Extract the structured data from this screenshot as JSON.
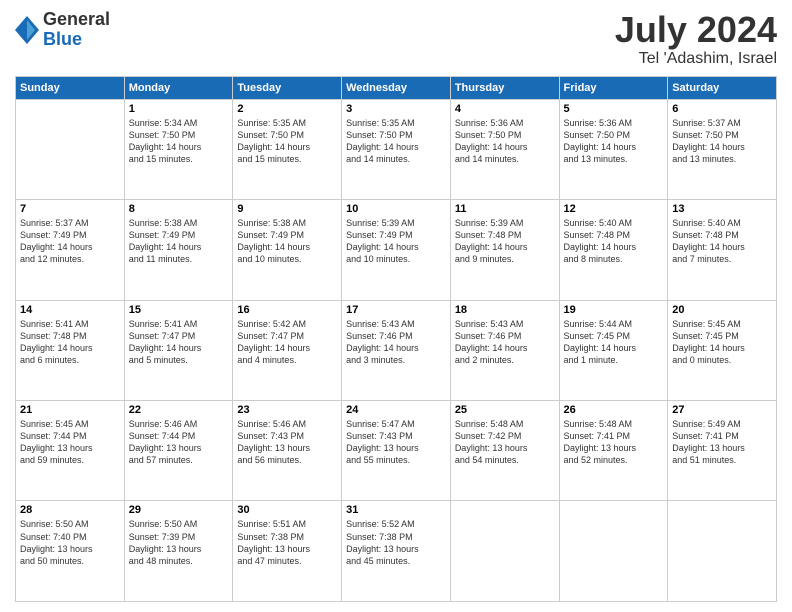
{
  "logo": {
    "general": "General",
    "blue": "Blue"
  },
  "header": {
    "month": "July 2024",
    "location": "Tel 'Adashim, Israel"
  },
  "weekdays": [
    "Sunday",
    "Monday",
    "Tuesday",
    "Wednesday",
    "Thursday",
    "Friday",
    "Saturday"
  ],
  "weeks": [
    [
      {
        "day": "",
        "info": ""
      },
      {
        "day": "1",
        "info": "Sunrise: 5:34 AM\nSunset: 7:50 PM\nDaylight: 14 hours\nand 15 minutes."
      },
      {
        "day": "2",
        "info": "Sunrise: 5:35 AM\nSunset: 7:50 PM\nDaylight: 14 hours\nand 15 minutes."
      },
      {
        "day": "3",
        "info": "Sunrise: 5:35 AM\nSunset: 7:50 PM\nDaylight: 14 hours\nand 14 minutes."
      },
      {
        "day": "4",
        "info": "Sunrise: 5:36 AM\nSunset: 7:50 PM\nDaylight: 14 hours\nand 14 minutes."
      },
      {
        "day": "5",
        "info": "Sunrise: 5:36 AM\nSunset: 7:50 PM\nDaylight: 14 hours\nand 13 minutes."
      },
      {
        "day": "6",
        "info": "Sunrise: 5:37 AM\nSunset: 7:50 PM\nDaylight: 14 hours\nand 13 minutes."
      }
    ],
    [
      {
        "day": "7",
        "info": "Sunrise: 5:37 AM\nSunset: 7:49 PM\nDaylight: 14 hours\nand 12 minutes."
      },
      {
        "day": "8",
        "info": "Sunrise: 5:38 AM\nSunset: 7:49 PM\nDaylight: 14 hours\nand 11 minutes."
      },
      {
        "day": "9",
        "info": "Sunrise: 5:38 AM\nSunset: 7:49 PM\nDaylight: 14 hours\nand 10 minutes."
      },
      {
        "day": "10",
        "info": "Sunrise: 5:39 AM\nSunset: 7:49 PM\nDaylight: 14 hours\nand 10 minutes."
      },
      {
        "day": "11",
        "info": "Sunrise: 5:39 AM\nSunset: 7:48 PM\nDaylight: 14 hours\nand 9 minutes."
      },
      {
        "day": "12",
        "info": "Sunrise: 5:40 AM\nSunset: 7:48 PM\nDaylight: 14 hours\nand 8 minutes."
      },
      {
        "day": "13",
        "info": "Sunrise: 5:40 AM\nSunset: 7:48 PM\nDaylight: 14 hours\nand 7 minutes."
      }
    ],
    [
      {
        "day": "14",
        "info": "Sunrise: 5:41 AM\nSunset: 7:48 PM\nDaylight: 14 hours\nand 6 minutes."
      },
      {
        "day": "15",
        "info": "Sunrise: 5:41 AM\nSunset: 7:47 PM\nDaylight: 14 hours\nand 5 minutes."
      },
      {
        "day": "16",
        "info": "Sunrise: 5:42 AM\nSunset: 7:47 PM\nDaylight: 14 hours\nand 4 minutes."
      },
      {
        "day": "17",
        "info": "Sunrise: 5:43 AM\nSunset: 7:46 PM\nDaylight: 14 hours\nand 3 minutes."
      },
      {
        "day": "18",
        "info": "Sunrise: 5:43 AM\nSunset: 7:46 PM\nDaylight: 14 hours\nand 2 minutes."
      },
      {
        "day": "19",
        "info": "Sunrise: 5:44 AM\nSunset: 7:45 PM\nDaylight: 14 hours\nand 1 minute."
      },
      {
        "day": "20",
        "info": "Sunrise: 5:45 AM\nSunset: 7:45 PM\nDaylight: 14 hours\nand 0 minutes."
      }
    ],
    [
      {
        "day": "21",
        "info": "Sunrise: 5:45 AM\nSunset: 7:44 PM\nDaylight: 13 hours\nand 59 minutes."
      },
      {
        "day": "22",
        "info": "Sunrise: 5:46 AM\nSunset: 7:44 PM\nDaylight: 13 hours\nand 57 minutes."
      },
      {
        "day": "23",
        "info": "Sunrise: 5:46 AM\nSunset: 7:43 PM\nDaylight: 13 hours\nand 56 minutes."
      },
      {
        "day": "24",
        "info": "Sunrise: 5:47 AM\nSunset: 7:43 PM\nDaylight: 13 hours\nand 55 minutes."
      },
      {
        "day": "25",
        "info": "Sunrise: 5:48 AM\nSunset: 7:42 PM\nDaylight: 13 hours\nand 54 minutes."
      },
      {
        "day": "26",
        "info": "Sunrise: 5:48 AM\nSunset: 7:41 PM\nDaylight: 13 hours\nand 52 minutes."
      },
      {
        "day": "27",
        "info": "Sunrise: 5:49 AM\nSunset: 7:41 PM\nDaylight: 13 hours\nand 51 minutes."
      }
    ],
    [
      {
        "day": "28",
        "info": "Sunrise: 5:50 AM\nSunset: 7:40 PM\nDaylight: 13 hours\nand 50 minutes."
      },
      {
        "day": "29",
        "info": "Sunrise: 5:50 AM\nSunset: 7:39 PM\nDaylight: 13 hours\nand 48 minutes."
      },
      {
        "day": "30",
        "info": "Sunrise: 5:51 AM\nSunset: 7:38 PM\nDaylight: 13 hours\nand 47 minutes."
      },
      {
        "day": "31",
        "info": "Sunrise: 5:52 AM\nSunset: 7:38 PM\nDaylight: 13 hours\nand 45 minutes."
      },
      {
        "day": "",
        "info": ""
      },
      {
        "day": "",
        "info": ""
      },
      {
        "day": "",
        "info": ""
      }
    ]
  ]
}
